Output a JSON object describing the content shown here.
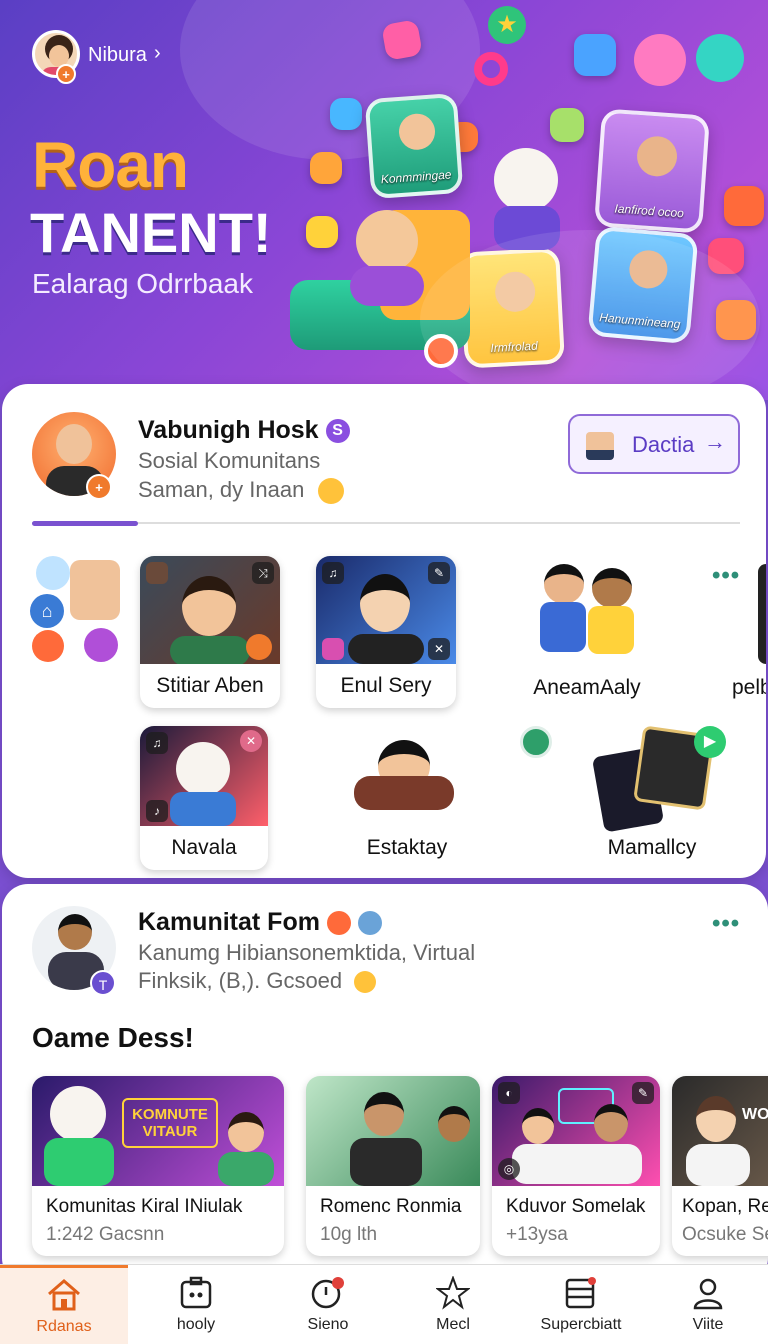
{
  "header": {
    "profile_name": "Nibura",
    "title_line1": "Roan",
    "title_line2": "TANENT!",
    "subtitle": "Ealarag Odrrbaak",
    "tile_labels": [
      "Konmmingae",
      "Ianfirod ocoo",
      "Irmfrolad",
      "Hanunmineang"
    ]
  },
  "profile_card": {
    "name": "Vabunigh Hosk",
    "line1": "Sosial Komunitans",
    "line2": "Saman, dy Inaan",
    "button_label": "Dactia",
    "progress": 0.15
  },
  "creators": {
    "row1": [
      "Stitiar Aben",
      "Enul Sery",
      "AneamAaly",
      "pelb"
    ],
    "row2": [
      "Navala",
      "Estaktay",
      "Mamallcy"
    ]
  },
  "feed_post": {
    "author": "Kamunitat Fom",
    "line1": "Kanumg Hibiansonemktida, Virtual",
    "line2": "Finksik, (B,). Gcsoed",
    "section_title": "Oame Dess!",
    "cards": [
      {
        "title": "Komunitas Kiral INiulak",
        "sub": "1:242 Gacsnn",
        "banner": "KOMNUTE VITAUR"
      },
      {
        "title": "Romenc Ronmia",
        "sub": "10g lth",
        "banner": ""
      },
      {
        "title": "Kduvor Somelak",
        "sub": "+13ysa",
        "banner": ""
      },
      {
        "title": "Kopan, Re",
        "sub": "Ocsuke Se",
        "banner": "WOU"
      }
    ]
  },
  "tabs": [
    {
      "label": "Rdanas",
      "icon": "home-icon",
      "active": true
    },
    {
      "label": "hooly",
      "icon": "camera-icon",
      "active": false
    },
    {
      "label": "Sieno",
      "icon": "timer-icon",
      "active": false
    },
    {
      "label": "Mecl",
      "icon": "star-icon",
      "active": false
    },
    {
      "label": "Supercbiatt",
      "icon": "list-icon",
      "active": false
    },
    {
      "label": "Viite",
      "icon": "user-icon",
      "active": false
    }
  ],
  "colors": {
    "accent": "#7a4fd0",
    "orange": "#f07a2c",
    "teal": "#2e8f78"
  }
}
